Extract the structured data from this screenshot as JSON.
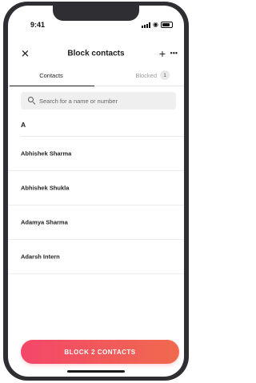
{
  "status_bar": {
    "time": "9:41"
  },
  "header": {
    "close_icon": "close-icon",
    "title": "Block contacts",
    "add_label": "+",
    "more_label": "•••"
  },
  "tabs": [
    {
      "label": "Contacts",
      "active": true
    },
    {
      "label": "Blocked",
      "badge": "1",
      "active": false
    }
  ],
  "search": {
    "placeholder": "Search for a name or number",
    "value": ""
  },
  "section": {
    "letter": "A"
  },
  "contacts": [
    {
      "name": "Abhishek Sharma"
    },
    {
      "name": "Abhishek Shukla"
    },
    {
      "name": "Adamya Sharma"
    },
    {
      "name": "Adarsh Intern"
    }
  ],
  "block_button": {
    "label": "BLOCK 2 CONTACTS"
  },
  "colors": {
    "accent_start": "#f4466a",
    "accent_end": "#f06a4e"
  }
}
